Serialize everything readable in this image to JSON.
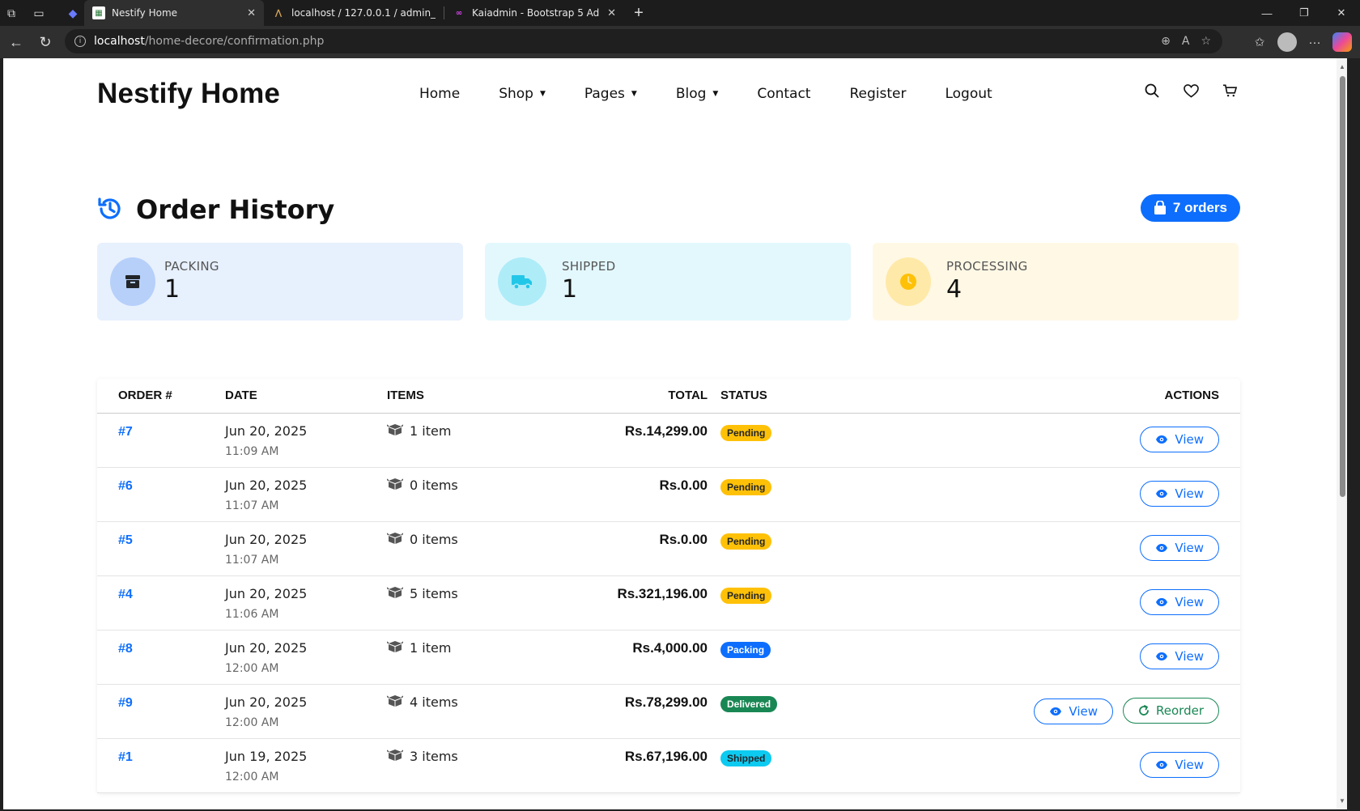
{
  "browser": {
    "tabs": [
      {
        "title": "Nestify Home",
        "active": true
      },
      {
        "title": "localhost / 127.0.0.1 / admin_hom",
        "active": false
      },
      {
        "title": "Kaiadmin - Bootstrap 5 Admin Da",
        "active": false
      }
    ],
    "url_host": "localhost",
    "url_path": "/home-decore/confirmation.php"
  },
  "header": {
    "brand": "Nestify Home",
    "nav": [
      {
        "label": "Home",
        "dropdown": false
      },
      {
        "label": "Shop",
        "dropdown": true
      },
      {
        "label": "Pages",
        "dropdown": true
      },
      {
        "label": "Blog",
        "dropdown": true
      },
      {
        "label": "Contact",
        "dropdown": false
      },
      {
        "label": "Register",
        "dropdown": false
      },
      {
        "label": "Logout",
        "dropdown": false
      }
    ]
  },
  "page": {
    "title": "Order History",
    "order_count": "7 orders"
  },
  "stats": [
    {
      "label": "PACKING",
      "value": "1",
      "icon": "box-icon",
      "bg": "#e7f0fd",
      "circle": "#b6d0fa",
      "icon_color": "#212529"
    },
    {
      "label": "SHIPPED",
      "value": "1",
      "icon": "truck-icon",
      "bg": "#e3f8fd",
      "circle": "#aeecf8",
      "icon_color": "#22c7e8"
    },
    {
      "label": "PROCESSING",
      "value": "4",
      "icon": "clock-icon",
      "bg": "#fff8e5",
      "circle": "#ffe9a8",
      "icon_color": "#ffc107"
    }
  ],
  "table": {
    "headers": {
      "order": "ORDER #",
      "date": "DATE",
      "items": "ITEMS",
      "total": "TOTAL",
      "status": "STATUS",
      "actions": "ACTIONS"
    },
    "rows": [
      {
        "order": "#7",
        "date": "Jun 20, 2025",
        "time": "11:09 AM",
        "items": "1 item",
        "total": "Rs.14,299.00",
        "status": "Pending",
        "reorder": false
      },
      {
        "order": "#6",
        "date": "Jun 20, 2025",
        "time": "11:07 AM",
        "items": "0 items",
        "total": "Rs.0.00",
        "status": "Pending",
        "reorder": false
      },
      {
        "order": "#5",
        "date": "Jun 20, 2025",
        "time": "11:07 AM",
        "items": "0 items",
        "total": "Rs.0.00",
        "status": "Pending",
        "reorder": false
      },
      {
        "order": "#4",
        "date": "Jun 20, 2025",
        "time": "11:06 AM",
        "items": "5 items",
        "total": "Rs.321,196.00",
        "status": "Pending",
        "reorder": false
      },
      {
        "order": "#8",
        "date": "Jun 20, 2025",
        "time": "12:00 AM",
        "items": "1 item",
        "total": "Rs.4,000.00",
        "status": "Packing",
        "reorder": false
      },
      {
        "order": "#9",
        "date": "Jun 20, 2025",
        "time": "12:00 AM",
        "items": "4 items",
        "total": "Rs.78,299.00",
        "status": "Delivered",
        "reorder": true
      },
      {
        "order": "#1",
        "date": "Jun 19, 2025",
        "time": "12:00 AM",
        "items": "3 items",
        "total": "Rs.67,196.00",
        "status": "Shipped",
        "reorder": false
      }
    ],
    "view_label": "View",
    "reorder_label": "Reorder"
  },
  "status_colors": {
    "Pending": {
      "bg": "#ffc107",
      "fg": "#212529"
    },
    "Packing": {
      "bg": "#0d6efd",
      "fg": "#ffffff"
    },
    "Delivered": {
      "bg": "#198754",
      "fg": "#ffffff"
    },
    "Shipped": {
      "bg": "#0dcaf0",
      "fg": "#212529"
    }
  },
  "colors": {
    "primary": "#0d6efd",
    "success": "#198754"
  }
}
